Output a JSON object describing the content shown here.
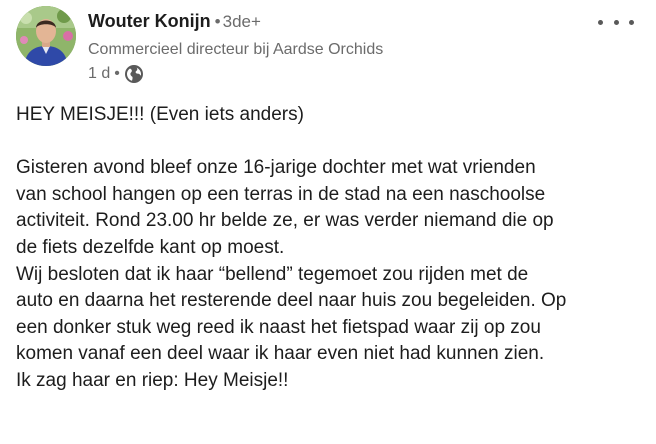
{
  "post": {
    "author": {
      "name": "Wouter Konijn",
      "separator": "•",
      "degree": "3de+",
      "headline": "Commercieel directeur bij Aardse Orchids",
      "time": "1 d",
      "meta_separator": "•",
      "visibility_icon": "globe-icon"
    },
    "menu_icon": "more-horizontal-icon",
    "body": {
      "title_line": "HEY MEISJE!!! (Even iets anders)",
      "lines": [
        "Gisteren avond bleef onze 16-jarige dochter met wat vrienden",
        "van school hangen op een terras in de stad na een naschoolse",
        "activiteit. Rond 23.00 hr belde ze, er was verder niemand die op",
        "de fiets dezelfde kant op moest.",
        "Wij besloten dat ik haar “bellend” tegemoet zou rijden met de",
        "auto en daarna het resterende deel naar huis zou begeleiden. Op",
        "een donker stuk weg reed ik naast het fietspad waar zij op zou",
        "komen vanaf een deel waar ik haar even niet had kunnen zien.",
        "Ik zag haar en riep: Hey Meisje!!"
      ]
    }
  }
}
